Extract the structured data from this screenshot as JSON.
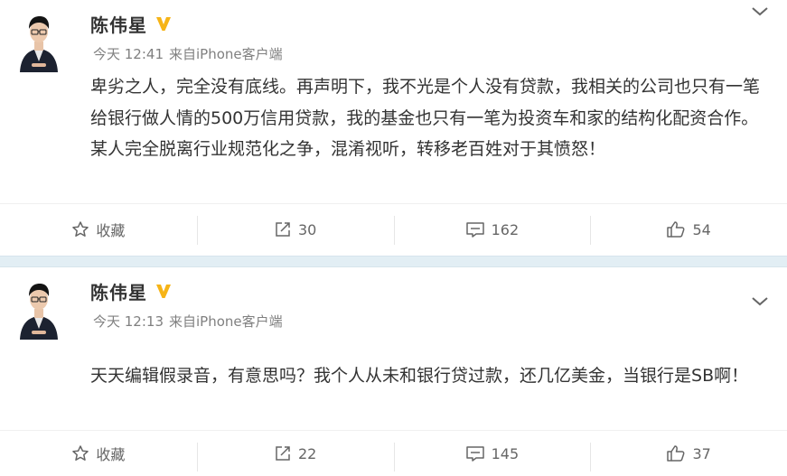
{
  "colors": {
    "vip_badge": "#f6b417",
    "separator_band": "#e2eef4",
    "meta_text": "#808080"
  },
  "posts": [
    {
      "username": "陈伟星",
      "time": "今天 12:41",
      "source_prefix": "来自",
      "source": "iPhone客户端",
      "text": "卑劣之人，完全没有底线。再声明下，我不光是个人没有贷款，我相关的公司也只有一笔给银行做人情的500万信用贷款，我的基金也只有一笔为投资车和家的结构化配资合作。某人完全脱离行业规范化之争，混淆视听，转移老百姓对于其愤怒！",
      "actions": {
        "favorite_label": "收藏",
        "repost_count": "30",
        "comment_count": "162",
        "like_count": "54"
      }
    },
    {
      "username": "陈伟星",
      "time": "今天 12:13",
      "source_prefix": "来自",
      "source": "iPhone客户端",
      "text": "天天编辑假录音，有意思吗？我个人从未和银行贷过款，还几亿美金，当银行是SB啊！",
      "actions": {
        "favorite_label": "收藏",
        "repost_count": "22",
        "comment_count": "145",
        "like_count": "37"
      }
    }
  ],
  "icons": [
    "avatar",
    "vip-badge-icon",
    "chevron-down-icon",
    "star-icon",
    "repost-icon",
    "comment-icon",
    "thumbs-up-icon"
  ]
}
